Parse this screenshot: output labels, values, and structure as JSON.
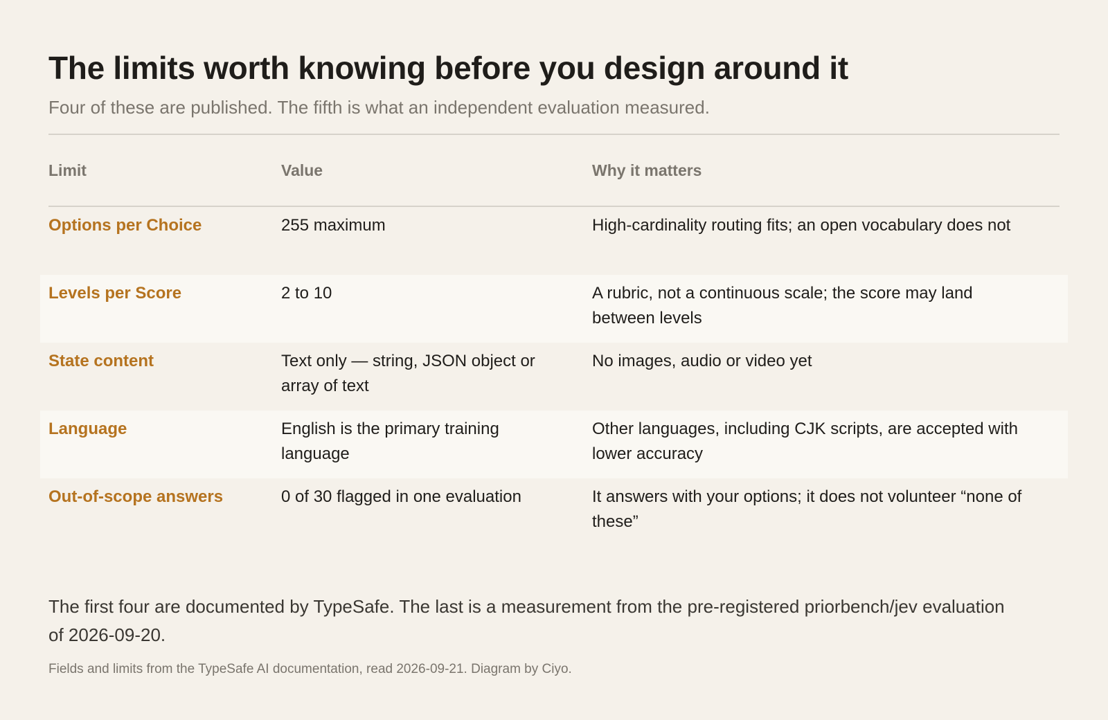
{
  "header": {
    "title": "The limits worth knowing before you design around it",
    "subtitle": "Four of these are published. The fifth is what an independent evaluation measured."
  },
  "table": {
    "columns": [
      "Limit",
      "Value",
      "Why it matters"
    ],
    "rows": [
      {
        "limit": "Options per Choice",
        "value": "255 maximum",
        "why": "High-cardinality routing fits; an open vocabulary does not"
      },
      {
        "limit": "Levels per Score",
        "value": "2 to 10",
        "why": "A rubric, not a continuous scale; the score may land between levels"
      },
      {
        "limit": "State content",
        "value": "Text only — string, JSON object or array of text",
        "why": "No images, audio or video yet"
      },
      {
        "limit": "Language",
        "value": "English is the primary training language",
        "why": "Other languages, including CJK scripts, are accepted with lower accuracy"
      },
      {
        "limit": "Out-of-scope answers",
        "value": "0 of 30 flagged in one evaluation",
        "why": "It answers with your options; it does not volunteer “none of these”"
      }
    ]
  },
  "footer": {
    "note": "The first four are documented by TypeSafe. The last is a measurement from the pre-registered priorbench/jev evaluation of 2026-09-20.",
    "credit": "Fields and limits from the TypeSafe AI documentation, read 2026-09-21. Diagram by Ciyo."
  },
  "colors": {
    "background": "#f5f1ea",
    "accent": "#b5731f",
    "muted": "#7a756d",
    "row_highlight": "#faf8f3"
  }
}
